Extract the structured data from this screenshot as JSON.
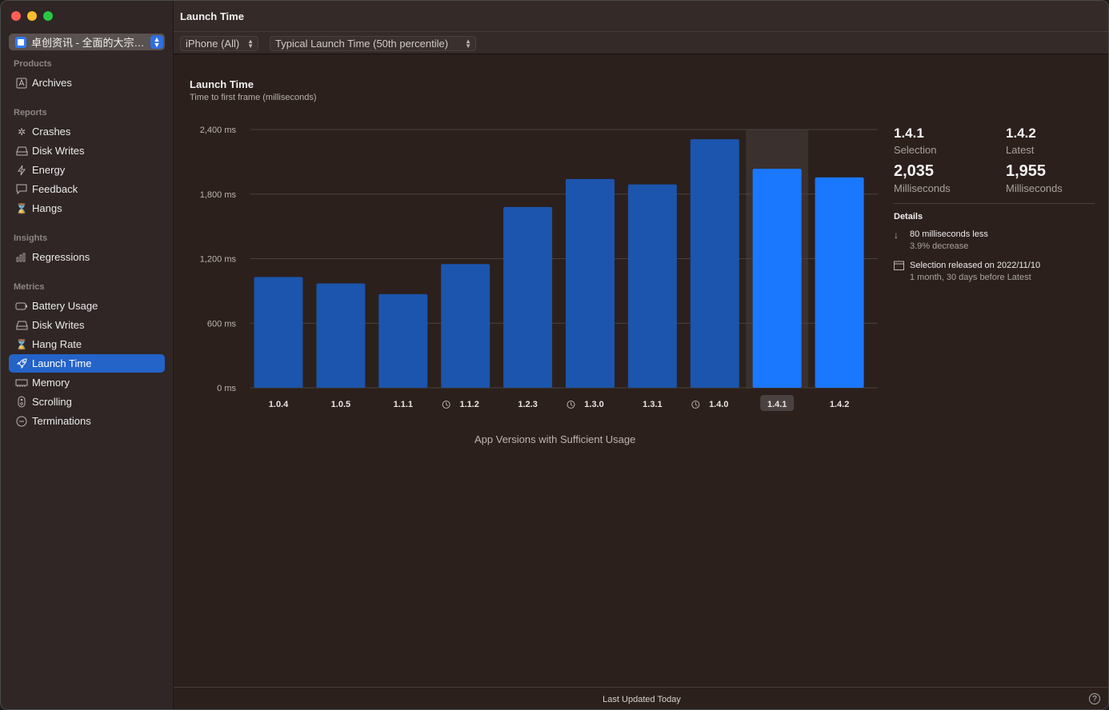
{
  "window": {
    "title": "Launch Time"
  },
  "sidebar": {
    "app_name": "卓创资讯 - 全面的大宗…",
    "sections": [
      {
        "title": "Products",
        "items": [
          {
            "label": "Archives",
            "icon": "archives-icon"
          }
        ]
      },
      {
        "title": "Reports",
        "items": [
          {
            "label": "Crashes",
            "icon": "crash-icon"
          },
          {
            "label": "Disk Writes",
            "icon": "disk-icon"
          },
          {
            "label": "Energy",
            "icon": "bolt-icon"
          },
          {
            "label": "Feedback",
            "icon": "feedback-icon"
          },
          {
            "label": "Hangs",
            "icon": "hourglass-icon"
          }
        ]
      },
      {
        "title": "Insights",
        "items": [
          {
            "label": "Regressions",
            "icon": "bars-icon"
          }
        ]
      },
      {
        "title": "Metrics",
        "items": [
          {
            "label": "Battery Usage",
            "icon": "battery-icon"
          },
          {
            "label": "Disk Writes",
            "icon": "disk-icon"
          },
          {
            "label": "Hang Rate",
            "icon": "hourglass-icon"
          },
          {
            "label": "Launch Time",
            "icon": "rocket-icon",
            "selected": true
          },
          {
            "label": "Memory",
            "icon": "memory-icon"
          },
          {
            "label": "Scrolling",
            "icon": "scroll-icon"
          },
          {
            "label": "Terminations",
            "icon": "terminate-icon"
          }
        ]
      }
    ]
  },
  "toolbar": {
    "device_filter": "iPhone (All)",
    "percentile_filter": "Typical Launch Time (50th percentile)"
  },
  "chart": {
    "title": "Launch Time",
    "subtitle": "Time to first frame (milliseconds)",
    "x_caption": "App Versions with Sufficient Usage"
  },
  "chart_data": {
    "type": "bar",
    "title": "Launch Time",
    "subtitle": "Time to first frame (milliseconds)",
    "xlabel": "App Versions with Sufficient Usage",
    "ylabel": "",
    "ylim": [
      0,
      2400
    ],
    "yticks": [
      "0 ms",
      "600 ms",
      "1,200 ms",
      "1,800 ms",
      "2,400 ms"
    ],
    "ytick_values": [
      0,
      600,
      1200,
      1800,
      2400
    ],
    "categories": [
      "1.0.4",
      "1.0.5",
      "1.1.1",
      "1.1.2",
      "1.2.3",
      "1.3.0",
      "1.3.1",
      "1.4.0",
      "1.4.1",
      "1.4.2"
    ],
    "values": [
      1030,
      970,
      870,
      1150,
      1680,
      1940,
      1890,
      2310,
      2035,
      1955
    ],
    "marked_versions": [
      "1.1.2",
      "1.3.0",
      "1.4.0"
    ],
    "selected": "1.4.1",
    "latest": "1.4.2",
    "colors": {
      "bar": "#1b55ad",
      "highlight": "#1a78ff",
      "grid": "#4a403d",
      "selection_bg": "#3a302d"
    }
  },
  "summary": {
    "selection": {
      "version": "1.4.1",
      "label": "Selection",
      "value": "2,035",
      "unit": "Milliseconds"
    },
    "latest": {
      "version": "1.4.2",
      "label": "Latest",
      "value": "1,955",
      "unit": "Milliseconds"
    },
    "details_title": "Details",
    "details": [
      {
        "icon": "arrow-down-icon",
        "main": "80 milliseconds less",
        "secondary": "3.9% decrease"
      },
      {
        "icon": "calendar-icon",
        "main": "Selection released on 2022/11/10",
        "secondary": "1 month, 30 days before Latest"
      }
    ]
  },
  "footer": {
    "updated": "Last Updated Today",
    "help": "?"
  }
}
